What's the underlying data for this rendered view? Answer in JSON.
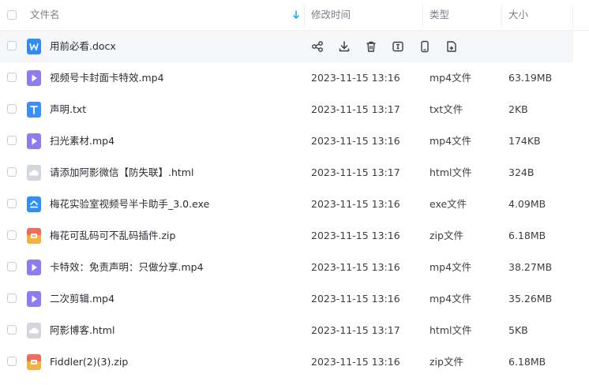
{
  "header": {
    "name_label": "文件名",
    "time_label": "修改时间",
    "type_label": "类型",
    "size_label": "大小"
  },
  "files": [
    {
      "name": "用前必看.docx",
      "time": "",
      "type": "",
      "size": "",
      "icon": "word-file-icon"
    },
    {
      "name": "视频号卡封面卡特效.mp4",
      "time": "2023-11-15 13:16",
      "type": "mp4文件",
      "size": "63.19MB",
      "icon": "video-file-icon"
    },
    {
      "name": "声明.txt",
      "time": "2023-11-15 13:17",
      "type": "txt文件",
      "size": "2KB",
      "icon": "text-file-icon"
    },
    {
      "name": "扫光素材.mp4",
      "time": "2023-11-15 13:16",
      "type": "mp4文件",
      "size": "174KB",
      "icon": "video-file-icon"
    },
    {
      "name": "请添加阿影微信【防失联】.html",
      "time": "2023-11-15 13:17",
      "type": "html文件",
      "size": "324B",
      "icon": "html-file-icon"
    },
    {
      "name": "梅花实验室视频号半卡助手_3.0.exe",
      "time": "2023-11-15 13:16",
      "type": "exe文件",
      "size": "4.09MB",
      "icon": "exe-file-icon"
    },
    {
      "name": "梅花可乱码可不乱码插件.zip",
      "time": "2023-11-15 13:16",
      "type": "zip文件",
      "size": "6.18MB",
      "icon": "zip-file-icon"
    },
    {
      "name": "卡特效：免责声明：只做分享.mp4",
      "time": "2023-11-15 13:16",
      "type": "mp4文件",
      "size": "38.27MB",
      "icon": "video-file-icon"
    },
    {
      "name": "二次剪辑.mp4",
      "time": "2023-11-15 13:16",
      "type": "mp4文件",
      "size": "35.26MB",
      "icon": "video-file-icon"
    },
    {
      "name": "阿影博客.html",
      "time": "2023-11-15 13:17",
      "type": "html文件",
      "size": "5KB",
      "icon": "html-file-icon"
    },
    {
      "name": "Fiddler(2)(3).zip",
      "time": "2023-11-15 13:16",
      "type": "zip文件",
      "size": "6.18MB",
      "icon": "zip-file-icon"
    }
  ],
  "hover_actions": [
    "share-icon",
    "download-icon",
    "delete-icon",
    "rename-icon",
    "phone-icon",
    "copy-icon"
  ],
  "colors": {
    "accent": "#06a7ff",
    "video": "#8f7bf0",
    "word": "#2f8cf6",
    "text": "#3d8ef7",
    "html": "#d3d6dc",
    "exe": "#2e8ff7",
    "zip_top": "#f36b5a",
    "zip_bottom": "#f5b13d"
  }
}
